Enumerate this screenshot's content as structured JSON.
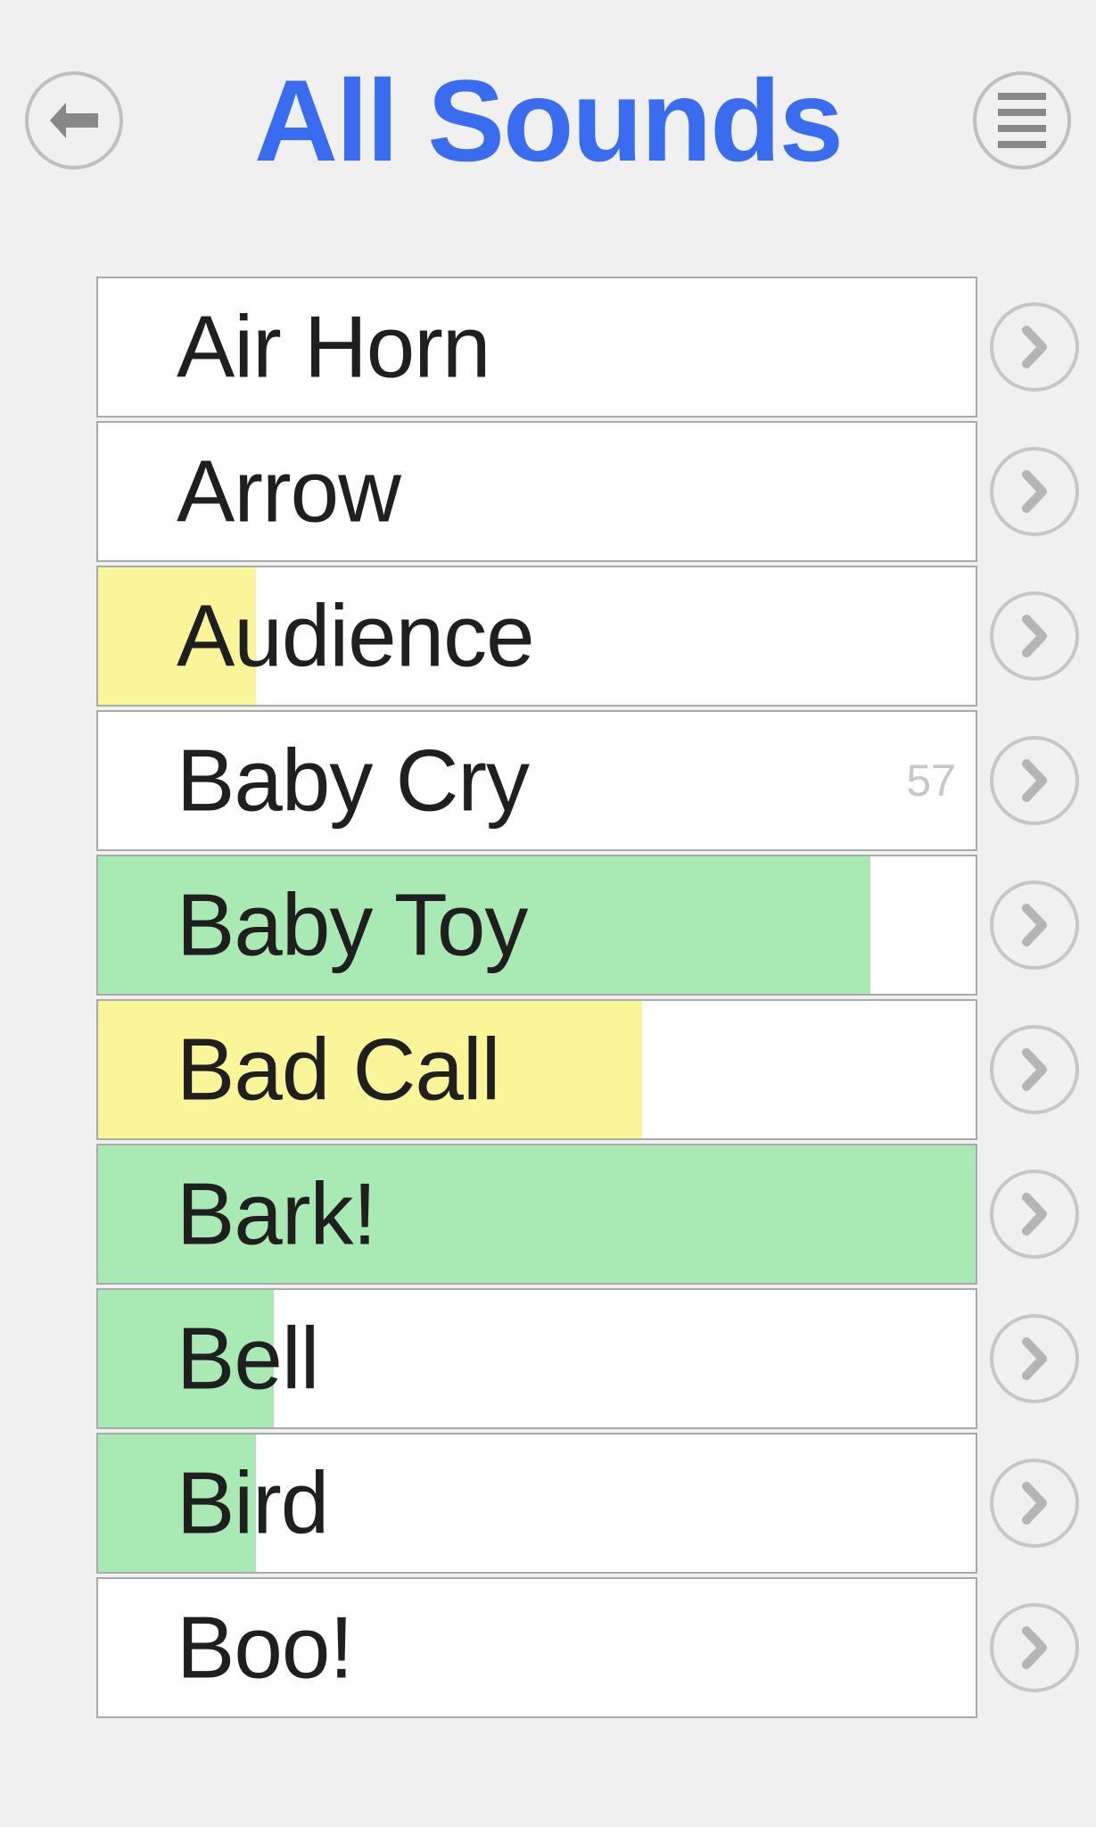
{
  "header": {
    "title": "All Sounds"
  },
  "colors": {
    "accent": "#3a6cf0",
    "fill_green": "#a8e9b4",
    "fill_yellow": "#fbf59a"
  },
  "sounds": [
    {
      "label": "Air Horn",
      "fill_percent": 0,
      "fill_color": "none",
      "badge": ""
    },
    {
      "label": "Arrow",
      "fill_percent": 0,
      "fill_color": "none",
      "badge": ""
    },
    {
      "label": "Audience",
      "fill_percent": 18,
      "fill_color": "yellow",
      "badge": ""
    },
    {
      "label": "Baby Cry",
      "fill_percent": 0,
      "fill_color": "none",
      "badge": "57"
    },
    {
      "label": "Baby Toy",
      "fill_percent": 88,
      "fill_color": "green",
      "badge": ""
    },
    {
      "label": "Bad Call",
      "fill_percent": 62,
      "fill_color": "yellow",
      "badge": ""
    },
    {
      "label": "Bark!",
      "fill_percent": 100,
      "fill_color": "green",
      "badge": ""
    },
    {
      "label": "Bell",
      "fill_percent": 20,
      "fill_color": "green",
      "badge": ""
    },
    {
      "label": "Bird",
      "fill_percent": 18,
      "fill_color": "green",
      "badge": ""
    },
    {
      "label": "Boo!",
      "fill_percent": 0,
      "fill_color": "none",
      "badge": ""
    }
  ]
}
